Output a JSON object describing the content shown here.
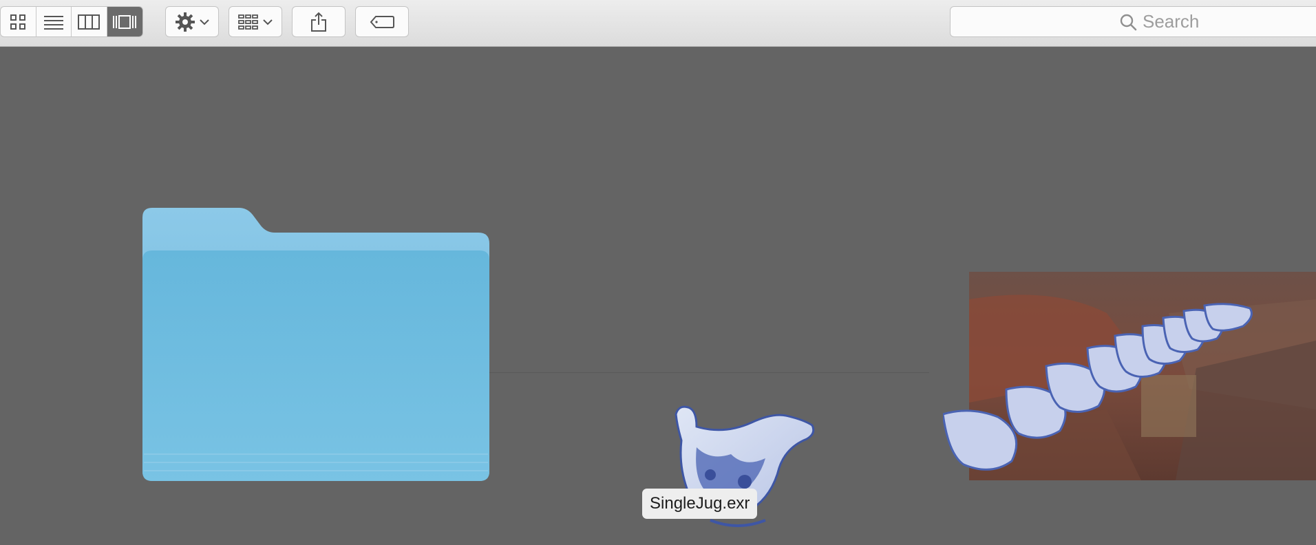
{
  "toolbar": {
    "view_modes": [
      "icon-view",
      "list-view",
      "column-view",
      "cover-flow-view"
    ],
    "active_view": "cover-flow-view"
  },
  "search": {
    "placeholder": "Search"
  },
  "coverflow": {
    "selected_file_name": "SingleJug.exr"
  },
  "colors": {
    "background": "#646464",
    "folder_blue": "#6cbde2",
    "active_segment": "#6b6b6b"
  }
}
